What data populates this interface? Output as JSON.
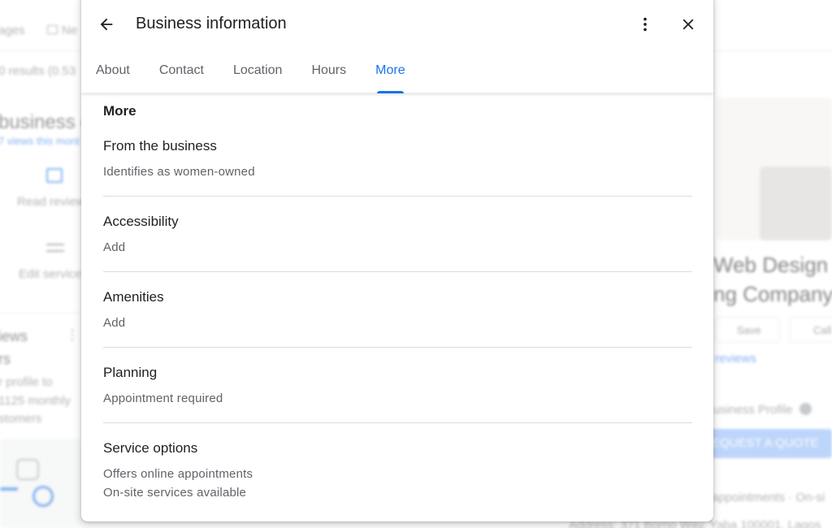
{
  "background": {
    "nav_partial_1": "ages",
    "nav_partial_2": "Ne",
    "results_partial": "0 results (0.53",
    "business_partial": "business o",
    "views_partial": "7 views this mont",
    "read_reviews_partial": "Read review",
    "edit_services_partial": "Edit service",
    "reviews_partial": "iews",
    "rs_partial": "rs",
    "profile_partial": "r profile to",
    "monthly_partial": "1125 monthly",
    "customers_partial": "stomers",
    "web_design_partial": "Web Design",
    "company_partial": "ng Company",
    "save_label": "Save",
    "call_label": "Call",
    "reviews_link_partial": "reviews",
    "business_profile_partial": "usiness Profile",
    "request_quote_partial": "EQUEST A QUOTE",
    "appointments_partial": "appointments · On-si",
    "address_partial": "Address: 371 Borno Way, Yaba 100001, Lagos",
    "colors": {
      "accent": "#1a73e8",
      "quote_button": "#8ab4f8"
    }
  },
  "dialog": {
    "title": "Business information",
    "icons": {
      "back": "arrow-back-icon",
      "menu": "more-vert-icon",
      "close": "close-icon"
    },
    "tabs": [
      {
        "label": "About",
        "active": false
      },
      {
        "label": "Contact",
        "active": false
      },
      {
        "label": "Location",
        "active": false
      },
      {
        "label": "Hours",
        "active": false
      },
      {
        "label": "More",
        "active": true
      }
    ],
    "section_heading": "More",
    "items": [
      {
        "title": "From the business",
        "values": [
          "Identifies as women-owned"
        ]
      },
      {
        "title": "Accessibility",
        "values": [
          "Add"
        ]
      },
      {
        "title": "Amenities",
        "values": [
          "Add"
        ]
      },
      {
        "title": "Planning",
        "values": [
          "Appointment required"
        ]
      },
      {
        "title": "Service options",
        "values": [
          "Offers online appointments",
          "On-site services available"
        ]
      }
    ]
  }
}
